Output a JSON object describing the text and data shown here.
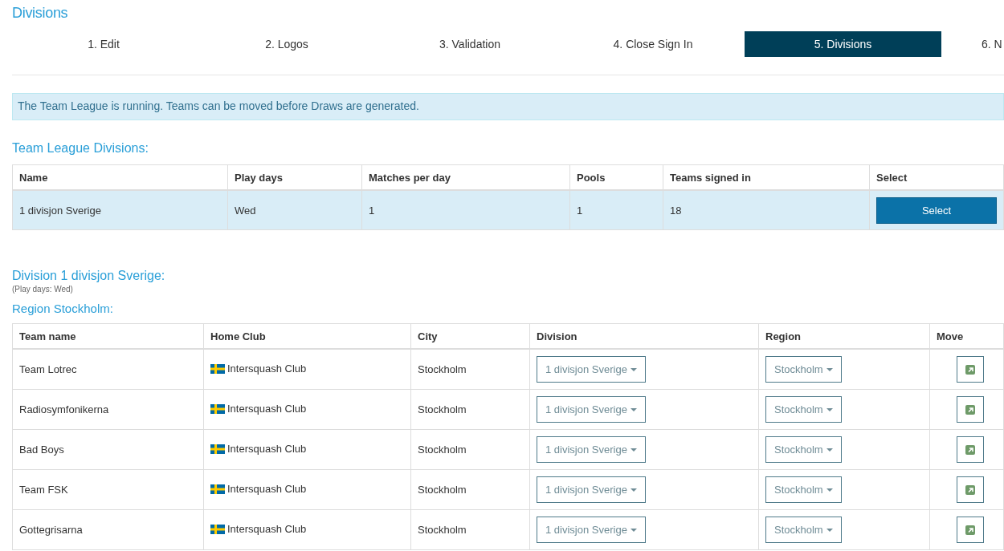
{
  "page_title": "Divisions",
  "steps": [
    {
      "label": "1. Edit",
      "selected": false
    },
    {
      "label": "2. Logos",
      "selected": false
    },
    {
      "label": "3. Validation",
      "selected": false
    },
    {
      "label": "4. Close Sign In",
      "selected": false
    },
    {
      "label": "5. Divisions",
      "selected": true
    },
    {
      "label": "6. N",
      "selected": false
    }
  ],
  "alert": "The Team League is running. Teams can be moved before Draws are generated.",
  "divisions_heading": "Team League Divisions:",
  "divisions_table": {
    "columns": [
      "Name",
      "Play days",
      "Matches per day",
      "Pools",
      "Teams signed in",
      "Select"
    ],
    "rows": [
      {
        "cells": [
          "1 divisjon Sverige",
          "Wed",
          "1",
          "1",
          "18"
        ],
        "button": "Select",
        "selected": true
      }
    ]
  },
  "division": {
    "heading": "Division 1 divisjon Sverige:",
    "note": "(Play days: Wed)",
    "region": "Region Stockholm:"
  },
  "teams_table": {
    "columns": [
      "Team name",
      "Home Club",
      "City",
      "Division",
      "Region",
      "Move"
    ],
    "rows": [
      {
        "team": "Team Lotrec",
        "club": "Intersquash Club",
        "city": "Stockholm",
        "division": "1 divisjon Sverige",
        "region": "Stockholm"
      },
      {
        "team": "Radiosymfonikerna",
        "club": "Intersquash Club",
        "city": "Stockholm",
        "division": "1 divisjon Sverige",
        "region": "Stockholm"
      },
      {
        "team": "Bad Boys",
        "club": "Intersquash Club",
        "city": "Stockholm",
        "division": "1 divisjon Sverige",
        "region": "Stockholm"
      },
      {
        "team": "Team FSK",
        "club": "Intersquash Club",
        "city": "Stockholm",
        "division": "1 divisjon Sverige",
        "region": "Stockholm"
      },
      {
        "team": "Gottegrisarna",
        "club": "Intersquash Club",
        "city": "Stockholm",
        "division": "1 divisjon Sverige",
        "region": "Stockholm"
      }
    ]
  }
}
